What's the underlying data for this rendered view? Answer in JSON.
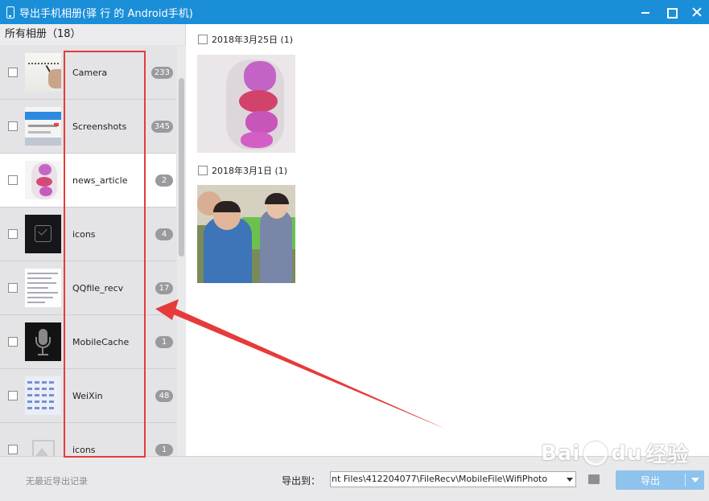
{
  "window": {
    "title": "导出手机相册(驿 行 的 Android手机)",
    "minimize_label": "minimize",
    "maximize_label": "maximize",
    "close_label": "close"
  },
  "albums_panel": {
    "header": "所有相册（18）",
    "items": [
      {
        "name": "Camera",
        "count": "233",
        "thumb": "handwriting-photo",
        "selected": false
      },
      {
        "name": "Screenshots",
        "count": "345",
        "thumb": "screenshot",
        "selected": false
      },
      {
        "name": "news_article",
        "count": "2",
        "thumb": "anatomy-image",
        "selected": true
      },
      {
        "name": "icons",
        "count": "4",
        "thumb": "check-box-icon",
        "selected": false
      },
      {
        "name": "QQfile_recv",
        "count": "17",
        "thumb": "document-page",
        "selected": false
      },
      {
        "name": "MobileCache",
        "count": "1",
        "thumb": "microphone-icon",
        "selected": false
      },
      {
        "name": "WeiXin",
        "count": "48",
        "thumb": "spreadsheet",
        "selected": false
      },
      {
        "name": "icons",
        "count": "1",
        "thumb": "image-placeholder-icon",
        "selected": false
      }
    ]
  },
  "photos_panel": {
    "groups": [
      {
        "date": "2018年3月25日 (1)",
        "photo": "anatomy-photo"
      },
      {
        "date": "2018年3月1日 (1)",
        "photo": "children-photo"
      }
    ]
  },
  "bottom_bar": {
    "no_record": "无最近导出记录",
    "export_to_label": "导出到：",
    "export_path": "nt Files\\412204077\\FileRecv\\MobileFile\\WifiPhoto",
    "export_button": "导出"
  },
  "watermark": {
    "brand": "Bai",
    "brand2": "du",
    "suffix": "经验"
  },
  "colors": {
    "titlebar": "#1b8ed8",
    "annotation": "#e63b3b",
    "export_button": "#8dc3ec"
  }
}
